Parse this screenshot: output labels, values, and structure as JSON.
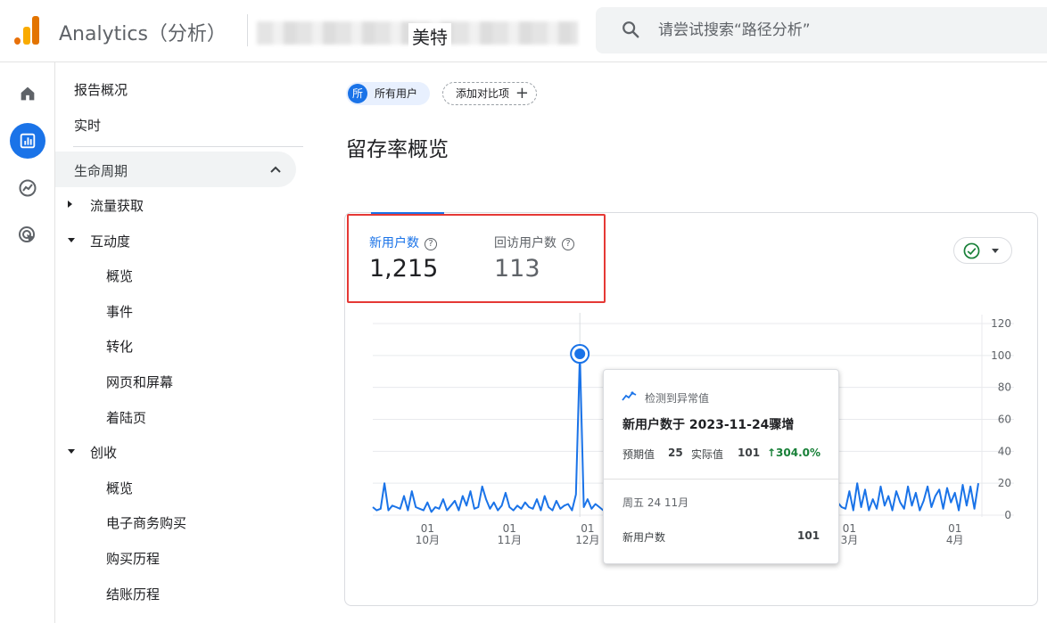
{
  "header": {
    "app_title": "Analytics（分析）",
    "account_name": "美特",
    "search_placeholder": "请尝试搜索“路径分析”"
  },
  "rail": {
    "icons": [
      "home-icon",
      "reports-icon",
      "explore-icon",
      "advertising-icon"
    ],
    "active_index": 1,
    "accent": "#1a73e8"
  },
  "nav": {
    "top_items": [
      "报告概况",
      "实时"
    ],
    "section": "生命周期",
    "groups": [
      {
        "label": "流量获取",
        "expanded": false,
        "children": []
      },
      {
        "label": "互动度",
        "expanded": true,
        "children": [
          "概览",
          "事件",
          "转化",
          "网页和屏幕",
          "着陆页"
        ]
      },
      {
        "label": "创收",
        "expanded": true,
        "children": [
          "概览",
          "电子商务购买",
          "购买历程",
          "结账历程"
        ]
      }
    ]
  },
  "main": {
    "chip_all_badge": "所",
    "chip_all_label": "所有用户",
    "chip_add_label": "添加对比项",
    "chip_add_plus": "+",
    "page_title": "留存率概览",
    "metrics": [
      {
        "label": "新用户数",
        "value": "1,215",
        "color": "#1a73e8"
      },
      {
        "label": "回访用户数",
        "value": "113",
        "color": "#5f6368"
      }
    ],
    "status_color": "#188038"
  },
  "tooltip": {
    "header": "检测到异常值",
    "title": "新用户数于 2023-11-24骤增",
    "expected_label": "预期值",
    "expected_value": "25",
    "actual_label": "实际值",
    "actual_value": "101",
    "change": "↑304.0%",
    "change_color": "#188038",
    "date": "周五 24 11月",
    "metric_label": "新用户数",
    "metric_value": "101"
  },
  "chart_data": {
    "type": "line",
    "ylim": [
      0,
      120
    ],
    "y_ticks": [
      0,
      20,
      40,
      60,
      80,
      100,
      120
    ],
    "x_ticks": [
      {
        "day": "01",
        "month": "10月",
        "index": 14
      },
      {
        "day": "01",
        "month": "11月",
        "index": 35
      },
      {
        "day": "01",
        "month": "12月",
        "index": 55
      },
      {
        "day": "01",
        "month": "2月",
        "index": 103
      },
      {
        "day": "01",
        "month": "3月",
        "index": 122
      },
      {
        "day": "01",
        "month": "4月",
        "index": 149
      }
    ],
    "series": [
      {
        "color": "#1a73e8",
        "anomaly_index": 53,
        "values": [
          5,
          3,
          4,
          20,
          3,
          6,
          5,
          4,
          12,
          3,
          15,
          5,
          4,
          3,
          8,
          2,
          5,
          4,
          10,
          3,
          6,
          9,
          3,
          12,
          6,
          15,
          4,
          5,
          18,
          10,
          4,
          8,
          3,
          6,
          14,
          5,
          3,
          6,
          4,
          8,
          5,
          4,
          10,
          3,
          12,
          5,
          3,
          9,
          4,
          6,
          7,
          3,
          13,
          101,
          5,
          10,
          4,
          7,
          5,
          3,
          8,
          6,
          4,
          9,
          5,
          12,
          3,
          7,
          5,
          11,
          4,
          6,
          9,
          3,
          14,
          5,
          8,
          4,
          10,
          6,
          3,
          12,
          5,
          8,
          4,
          9,
          6,
          3,
          11,
          5,
          7,
          4,
          13,
          5,
          3,
          8,
          6,
          10,
          4,
          7,
          5,
          9,
          3,
          12,
          5,
          6,
          8,
          4,
          11,
          3,
          7,
          5,
          10,
          6,
          4,
          9,
          3,
          12,
          6,
          8,
          5,
          4,
          15,
          3,
          20,
          5,
          16,
          3,
          10,
          4,
          18,
          6,
          12,
          3,
          15,
          8,
          4,
          18,
          6,
          14,
          3,
          9,
          18,
          5,
          12,
          16,
          4,
          17,
          8,
          14,
          3,
          19,
          6,
          18,
          4,
          20
        ]
      }
    ]
  }
}
